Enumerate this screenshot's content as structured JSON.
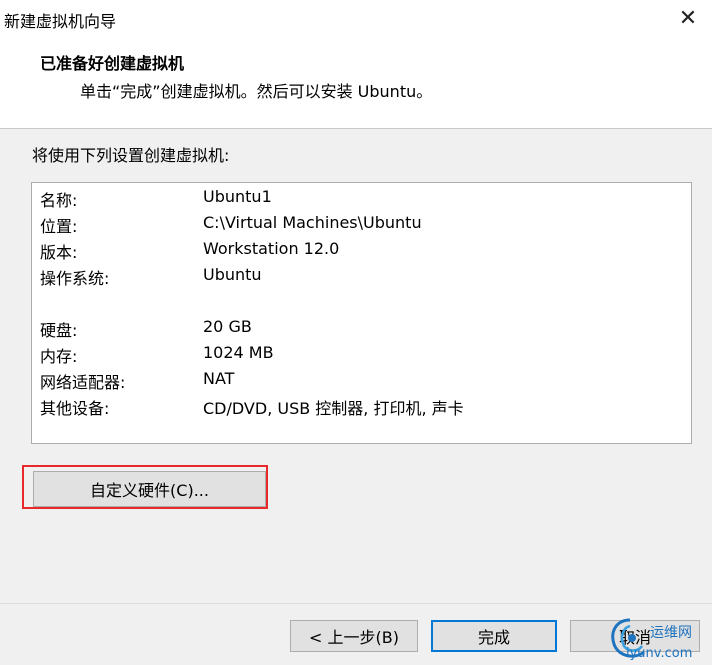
{
  "window": {
    "title": "新建虚拟机向导",
    "close_glyph": "✕"
  },
  "header": {
    "heading": "已准备好创建虚拟机",
    "subheading": "单击“完成”创建虚拟机。然后可以安装 Ubuntu。"
  },
  "intro": "将使用下列设置创建虚拟机:",
  "summary": {
    "rows": [
      {
        "label": "名称:",
        "value": "Ubuntu1"
      },
      {
        "label": "位置:",
        "value": "C:\\Virtual Machines\\Ubuntu"
      },
      {
        "label": "版本:",
        "value": "Workstation 12.0"
      },
      {
        "label": "操作系统:",
        "value": "Ubuntu"
      },
      {
        "label": "硬盘:",
        "value": "20 GB"
      },
      {
        "label": "内存:",
        "value": "1024 MB"
      },
      {
        "label": "网络适配器:",
        "value": "NAT"
      },
      {
        "label": "其他设备:",
        "value": "CD/DVD, USB 控制器, 打印机, 声卡"
      }
    ]
  },
  "buttons": {
    "customize": "自定义硬件(C)...",
    "back": "< 上一步(B)",
    "finish": "完成",
    "cancel": "取消"
  },
  "watermark": {
    "line1": "运维网",
    "line2": "iyunv.com"
  },
  "colors": {
    "highlight_border": "#e8292b",
    "default_button_border": "#0078d7"
  },
  "icons": {
    "close": "close-icon",
    "watermark_logo": "swirl-logo"
  }
}
